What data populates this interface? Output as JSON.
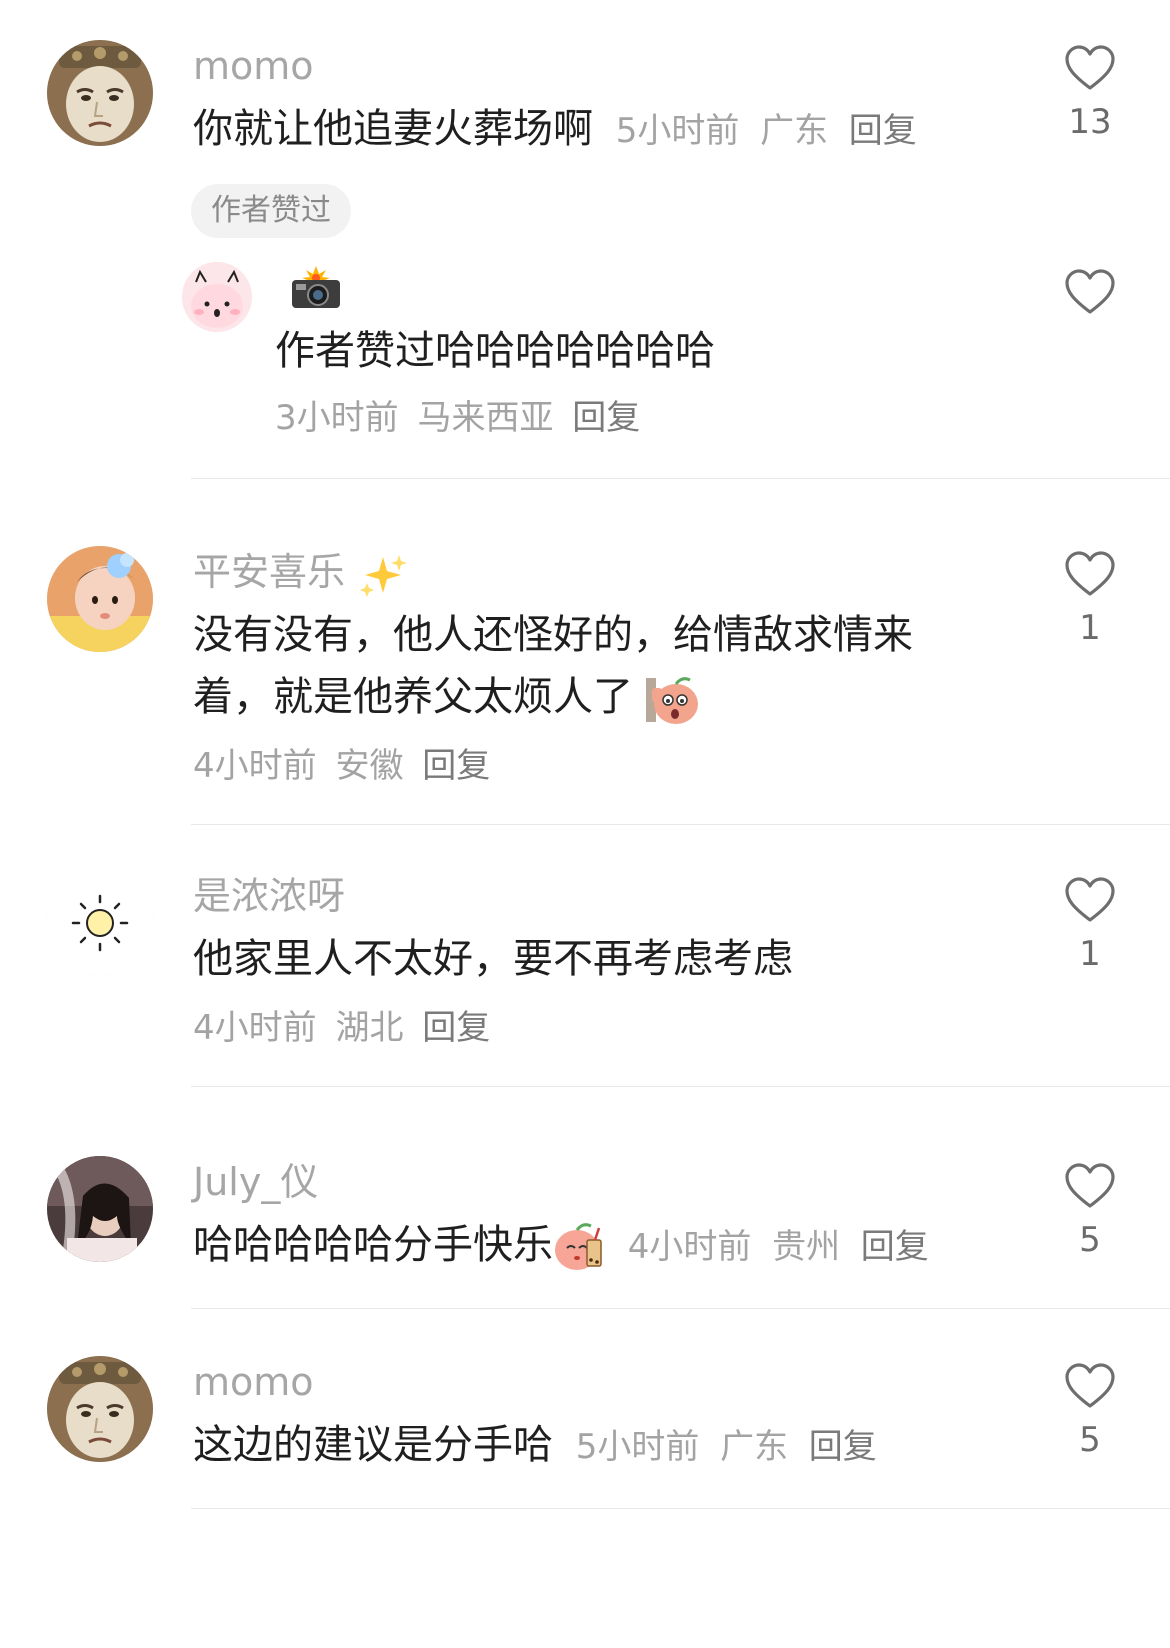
{
  "comments": [
    {
      "username": "momo",
      "text": "你就让他追妻火葬场啊",
      "time": "5小时前",
      "location": "广东",
      "reply_label": "回复",
      "likes": "13",
      "badge": "作者赞过",
      "sub_reply": {
        "text": "作者赞过哈哈哈哈哈哈哈",
        "time": "3小时前",
        "location": "马来西亚",
        "reply_label": "回复"
      }
    },
    {
      "username": "平安喜乐",
      "text_line1": "没有没有，他人还怪好的，给情敌求情来",
      "text_line2": "着，就是他养父太烦人了",
      "time": "4小时前",
      "location": "安徽",
      "reply_label": "回复",
      "likes": "1"
    },
    {
      "username": "是浓浓呀",
      "text": "他家里人不太好，要不再考虑考虑",
      "time": "4小时前",
      "location": "湖北",
      "reply_label": "回复",
      "likes": "1"
    },
    {
      "username": "July_仪",
      "text": "哈哈哈哈哈分手快乐",
      "time": "4小时前",
      "location": "贵州",
      "reply_label": "回复",
      "likes": "5"
    },
    {
      "username": "momo",
      "text": "这边的建议是分手哈",
      "time": "5小时前",
      "location": "广东",
      "reply_label": "回复",
      "likes": "5"
    }
  ],
  "icons": {
    "like": "heart-outline-icon",
    "sparkle": "sparkles-emoji",
    "camera": "camera-flash-emoji",
    "peach_shy": "peach-peeking-emoji",
    "peach_tea": "peach-milk-tea-emoji"
  },
  "colors": {
    "username": "#a6a6a6",
    "text": "#1f1f1f",
    "meta": "#a3a3a3",
    "divider": "#e8e8e8",
    "badge_bg": "#f2f2f2"
  }
}
